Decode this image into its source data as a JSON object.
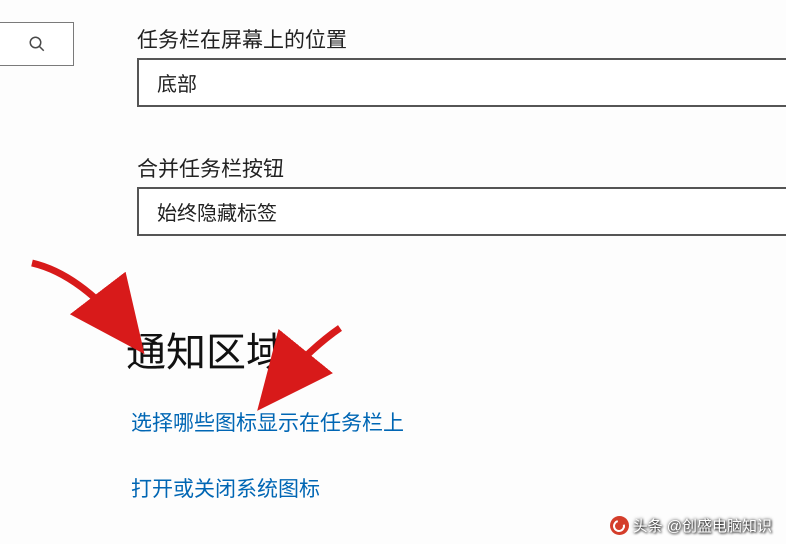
{
  "search": {
    "placeholder": ""
  },
  "labels": {
    "position": "任务栏在屏幕上的位置",
    "combine": "合并任务栏按钮"
  },
  "dropdowns": {
    "position_value": "底部",
    "combine_value": "始终隐藏标签"
  },
  "section_heading": "通知区域",
  "links": {
    "select_icons": "选择哪些图标显示在任务栏上",
    "system_icons": "打开或关闭系统图标"
  },
  "watermark": "头条 @创盛电脑知识"
}
